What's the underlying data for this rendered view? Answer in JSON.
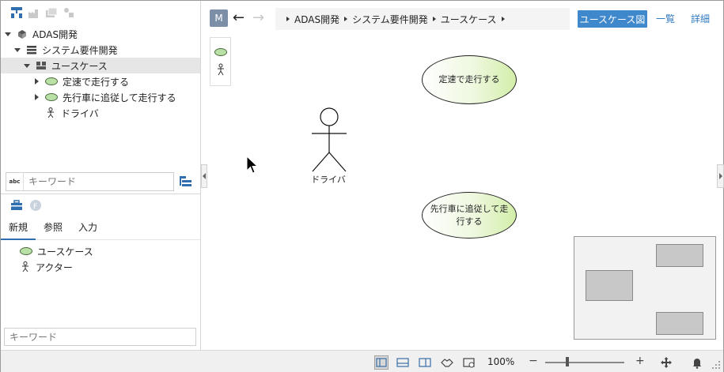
{
  "tree": {
    "items": [
      {
        "label": "ADAS開発"
      },
      {
        "label": "システム要件開発"
      },
      {
        "label": "ユースケース"
      },
      {
        "label": "定速で走行する"
      },
      {
        "label": "先行車に追従して走行する"
      },
      {
        "label": "ドライバ"
      }
    ]
  },
  "search": {
    "placeholder": "キーワード",
    "abc_label": "abc"
  },
  "palette_tabs": [
    "新規",
    "参照",
    "入力"
  ],
  "palette_items": [
    {
      "label": "ユースケース"
    },
    {
      "label": "アクター"
    }
  ],
  "palette_search": {
    "placeholder": "キーワード"
  },
  "header": {
    "m_badge": "M",
    "back": "←",
    "forward": "→",
    "breadcrumb": [
      "ADAS開発",
      "システム要件開発",
      "ユースケース"
    ],
    "view_button": "ユースケース図",
    "list_link": "一覧",
    "detail_link": "詳細"
  },
  "diagram": {
    "usecase1": "定速で走行する",
    "usecase2": "先行車に追従して走行する",
    "actor": "ドライバ"
  },
  "statusbar": {
    "zoom": "100%",
    "minus": "−",
    "plus": "+"
  },
  "colors": {
    "accent": "#3f88cc",
    "usecase_fill": "#d3eeaa",
    "icon_blue": "#2f6fb0"
  }
}
